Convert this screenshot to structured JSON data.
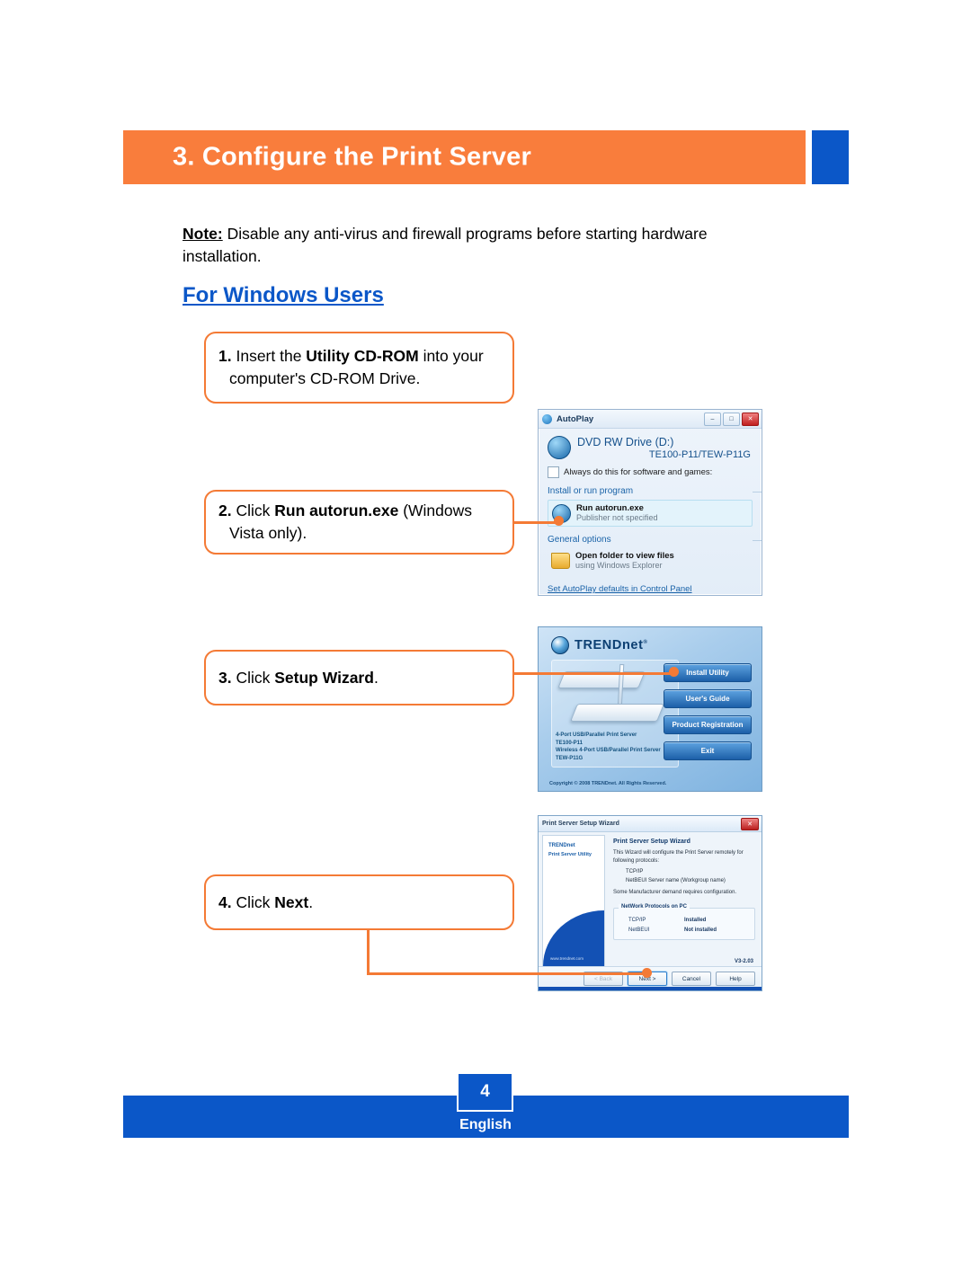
{
  "header": {
    "title": "3. Configure the Print Server",
    "orange": "#F97D3C",
    "blue": "#0B57C8"
  },
  "note": {
    "label": "Note:",
    "text": " Disable any anti-virus and firewall programs before starting hardware installation."
  },
  "section_title": "For Windows Users",
  "steps": [
    {
      "num": "1.",
      "pre": " Insert the ",
      "bold": "Utility CD-ROM",
      "post": " into your computer's CD-ROM Drive."
    },
    {
      "num": "2.",
      "pre": " Click ",
      "bold": "Run autorun.exe",
      "post": " (Windows Vista only)."
    },
    {
      "num": "3.",
      "pre": " Click ",
      "bold": "Setup Wizard",
      "post": "."
    },
    {
      "num": "4.",
      "pre": " Click ",
      "bold": "Next",
      "post": "."
    }
  ],
  "autoplay": {
    "window_title": "AutoPlay",
    "minimize": "–",
    "maximize": "□",
    "close": "✕",
    "drive_name": "DVD RW Drive (D:)",
    "volume_label": "TE100-P11/TEW-P11G",
    "checkbox_label": "Always do this for software and games:",
    "group1": "Install or run program",
    "item1_title": "Run autorun.exe",
    "item1_sub": "Publisher not specified",
    "group2": "General options",
    "item2_title": "Open folder to view files",
    "item2_sub": "using Windows Explorer",
    "footer_link": "Set AutoPlay defaults in Control Panel"
  },
  "autorun": {
    "brand": "TRENDnet",
    "trademark": "®",
    "buttons": [
      "Install Utility",
      "User's Guide",
      "Product Registration",
      "Exit"
    ],
    "caption_line1": "4-Port USB/Parallel Print Server",
    "caption_line2": "TE100-P11",
    "caption_line3": "Wireless 4-Port USB/Parallel Print Server",
    "caption_line4": "TEW-P11G",
    "copyright": "Copyright © 2008 TRENDnet. All Rights Reserved."
  },
  "wizard": {
    "window_title": "Print Server Setup Wizard",
    "close": "✕",
    "side_brand": "TRENDnet",
    "side_sub": "Print Server Utility",
    "side_url": "www.trendnet.com",
    "heading": "Print Server Setup Wizard",
    "paragraph": "This Wizard will configure the Print Server remotely for following protocols:",
    "list1": "TCP/IP",
    "list2": "NetBEUI Server name (Workgroup name)",
    "note": "Some Manufacturer demand requires configuration.",
    "group_label": "NetWork Protocols on PC",
    "rows": [
      {
        "key": "TCP/IP",
        "value": "Installed"
      },
      {
        "key": "NetBEUI",
        "value": "Not installed"
      }
    ],
    "version": "V3-2.03",
    "buttons": {
      "back": "< Back",
      "next": "Next >",
      "cancel": "Cancel",
      "help": "Help"
    }
  },
  "footer": {
    "page_number": "4",
    "language": "English"
  }
}
